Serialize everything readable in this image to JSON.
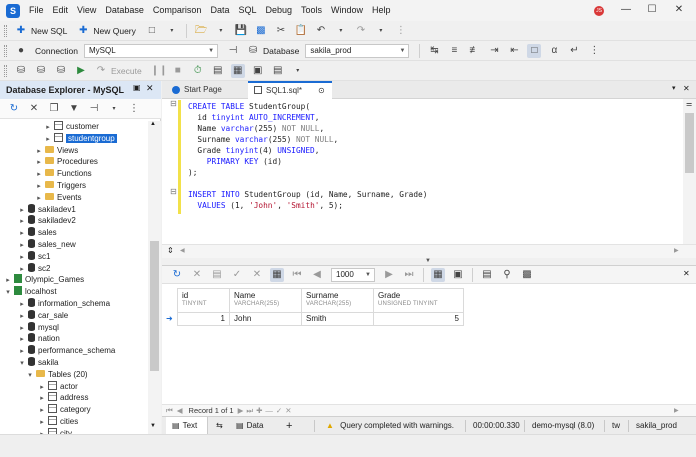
{
  "app": {
    "logo_letter": "S"
  },
  "menu": [
    "File",
    "Edit",
    "View",
    "Database",
    "Comparison",
    "Data",
    "SQL",
    "Debug",
    "Tools",
    "Window",
    "Help"
  ],
  "user_badge": "JS",
  "toolbar1": {
    "new_sql": "New SQL",
    "new_query": "New Query"
  },
  "toolbar2": {
    "connection_label": "Connection",
    "connection_value": "MySQL",
    "database_label": "Database",
    "database_value": "sakila_prod"
  },
  "toolbar3": {
    "execute": "Execute"
  },
  "explorer": {
    "title": "Database Explorer - MySQL",
    "tree": [
      {
        "label": "customer",
        "icon": "table-icon",
        "expander": "▸"
      },
      {
        "label": "studentgroup",
        "icon": "table-icon",
        "expander": "▸"
      },
      {
        "label": "Views",
        "icon": "folder-icon",
        "expander": "▸"
      },
      {
        "label": "Procedures",
        "icon": "folder-icon",
        "expander": "▸"
      },
      {
        "label": "Functions",
        "icon": "folder-icon",
        "expander": "▸"
      },
      {
        "label": "Triggers",
        "icon": "folder-icon",
        "expander": "▸"
      },
      {
        "label": "Events",
        "icon": "folder-icon",
        "expander": "▸"
      },
      {
        "label": "sakiladev1",
        "icon": "database-icon",
        "expander": "▸"
      },
      {
        "label": "sakiladev2",
        "icon": "database-icon",
        "expander": "▸"
      },
      {
        "label": "sales",
        "icon": "database-icon",
        "expander": "▸"
      },
      {
        "label": "sales_new",
        "icon": "database-icon",
        "expander": "▸"
      },
      {
        "label": "sc1",
        "icon": "database-icon",
        "expander": "▸"
      },
      {
        "label": "sc2",
        "icon": "database-icon",
        "expander": "▸"
      },
      {
        "label": "Olympic_Games",
        "icon": "server-icon",
        "expander": "▸"
      },
      {
        "label": "localhost",
        "icon": "server-icon",
        "expander": "▾"
      },
      {
        "label": "information_schema",
        "icon": "database-icon",
        "expander": "▸"
      },
      {
        "label": "car_sale",
        "icon": "database-icon",
        "expander": "▸"
      },
      {
        "label": "mysql",
        "icon": "database-icon",
        "expander": "▸"
      },
      {
        "label": "nation",
        "icon": "database-icon",
        "expander": "▸"
      },
      {
        "label": "performance_schema",
        "icon": "database-icon",
        "expander": "▸"
      },
      {
        "label": "sakila",
        "icon": "database-icon",
        "expander": "▾"
      },
      {
        "label": "Tables (20)",
        "icon": "folder-icon",
        "expander": "▾"
      },
      {
        "label": "actor",
        "icon": "table-icon",
        "expander": "▸"
      },
      {
        "label": "address",
        "icon": "table-icon",
        "expander": "▸"
      },
      {
        "label": "category",
        "icon": "table-icon",
        "expander": "▸"
      },
      {
        "label": "cities",
        "icon": "table-icon",
        "expander": "▸"
      },
      {
        "label": "city",
        "icon": "table-icon",
        "expander": "▸"
      }
    ]
  },
  "tabs": [
    {
      "label": "Start Page"
    },
    {
      "label": "SQL1.sql*"
    }
  ],
  "editor": {
    "lines": [
      [
        [
          "kw",
          "CREATE TABLE "
        ],
        [
          "pl",
          "StudentGroup("
        ]
      ],
      [
        [
          "pl",
          "  id "
        ],
        [
          "ty",
          "tinyint AUTO_INCREMENT"
        ],
        [
          "pl",
          ","
        ]
      ],
      [
        [
          "pl",
          "  Name "
        ],
        [
          "ty",
          "varchar"
        ],
        [
          "pl",
          "(255) "
        ],
        [
          "dim",
          "NOT NULL"
        ],
        [
          "pl",
          ","
        ]
      ],
      [
        [
          "pl",
          "  Surname "
        ],
        [
          "ty",
          "varchar"
        ],
        [
          "pl",
          "(255) "
        ],
        [
          "dim",
          "NOT NULL"
        ],
        [
          "pl",
          ","
        ]
      ],
      [
        [
          "pl",
          "  Grade "
        ],
        [
          "ty",
          "tinyint"
        ],
        [
          "pl",
          "(4) "
        ],
        [
          "ty",
          "UNSIGNED"
        ],
        [
          "pl",
          ","
        ]
      ],
      [
        [
          "kw",
          "    PRIMARY KEY "
        ],
        [
          "pl",
          "(id)"
        ]
      ],
      [
        [
          "pl",
          ");"
        ]
      ],
      [],
      [
        [
          "kw",
          "INSERT INTO "
        ],
        [
          "pl",
          "StudentGroup (id, Name, Surname, Grade)"
        ]
      ],
      [
        [
          "kw",
          "  VALUES "
        ],
        [
          "pl",
          "(1, "
        ],
        [
          "str",
          "'John'"
        ],
        [
          "pl",
          ", "
        ],
        [
          "str",
          "'Smith'"
        ],
        [
          "pl",
          ", 5);"
        ]
      ]
    ]
  },
  "results": {
    "page_size": "1000",
    "columns": [
      {
        "name": "id",
        "type": "TINYINT"
      },
      {
        "name": "Name",
        "type": "VARCHAR(255)"
      },
      {
        "name": "Surname",
        "type": "VARCHAR(255)"
      },
      {
        "name": "Grade",
        "type": "UNSIGNED TINYINT"
      }
    ],
    "rows": [
      [
        "1",
        "John",
        "Smith",
        "5"
      ]
    ],
    "navigator": "Record 1 of 1"
  },
  "status": {
    "text_tab": "Text",
    "data_tab": "Data",
    "add": "+",
    "message": "Query completed with warnings.",
    "duration": "00:00:00.330",
    "connection": "demo-mysql (8.0)",
    "user": "tw",
    "database": "sakila_prod"
  }
}
